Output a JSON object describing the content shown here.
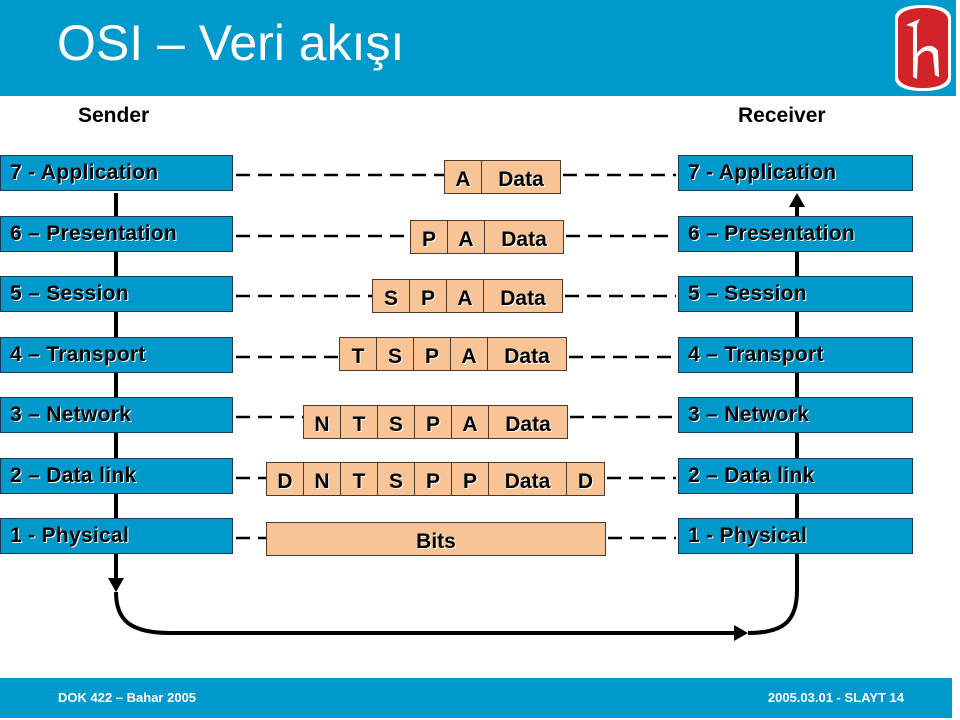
{
  "header": {
    "title": "OSI – Veri akışı",
    "logo": "hacettepe-h-logo"
  },
  "colors": {
    "accent": "#0099CC",
    "packet_fill": "#F9C495",
    "logo_red": "#D2232A"
  },
  "sender": {
    "label": "Sender",
    "layers": [
      "7 - Application",
      "6 – Presentation",
      "5 – Session",
      "4 – Transport",
      "3 – Network",
      "2 – Data link",
      "1 - Physical"
    ]
  },
  "receiver": {
    "label": "Receiver",
    "layers": [
      "7 - Application",
      "6 – Presentation",
      "5 – Session",
      "4 – Transport",
      "3 – Network",
      "2 – Data link",
      "1 - Physical"
    ]
  },
  "packets": [
    {
      "layer": 7,
      "cells": [
        "A",
        "Data"
      ]
    },
    {
      "layer": 6,
      "cells": [
        "P",
        "A",
        "Data"
      ]
    },
    {
      "layer": 5,
      "cells": [
        "S",
        "P",
        "A",
        "Data"
      ]
    },
    {
      "layer": 4,
      "cells": [
        "T",
        "S",
        "P",
        "A",
        "Data"
      ]
    },
    {
      "layer": 3,
      "cells": [
        "N",
        "T",
        "S",
        "P",
        "A",
        "Data"
      ]
    },
    {
      "layer": 2,
      "cells": [
        "D",
        "N",
        "T",
        "S",
        "P",
        "P",
        "Data",
        "D"
      ]
    },
    {
      "layer": 1,
      "cells": [
        "Bits"
      ]
    }
  ],
  "footer": {
    "left": "DOK 422 – Bahar 2005",
    "right": "2005.03.01 - SLAYT 14"
  }
}
